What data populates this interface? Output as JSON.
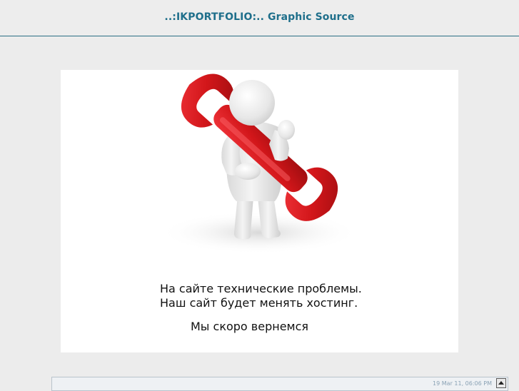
{
  "header": {
    "title": "..:IKPORTFOLIO:.. Graphic Source"
  },
  "main": {
    "illustration_name": "3d-man-with-wrench",
    "message_line_1": "На сайте технические проблемы.",
    "message_line_2": "Наш сайт будет менять хостинг.",
    "message_line_3": "Мы скоро вернемся"
  },
  "footer": {
    "timestamp": "19 Mar 11, 06:06 PM",
    "scroll_icon": "arrow-up-icon"
  },
  "colors": {
    "page_bg": "#ececec",
    "header_text": "#1f6f8b",
    "header_rule": "#2a6f84",
    "panel_bg": "#ffffff",
    "wrench": "#d2161a",
    "figure": "#e8e8e8"
  }
}
